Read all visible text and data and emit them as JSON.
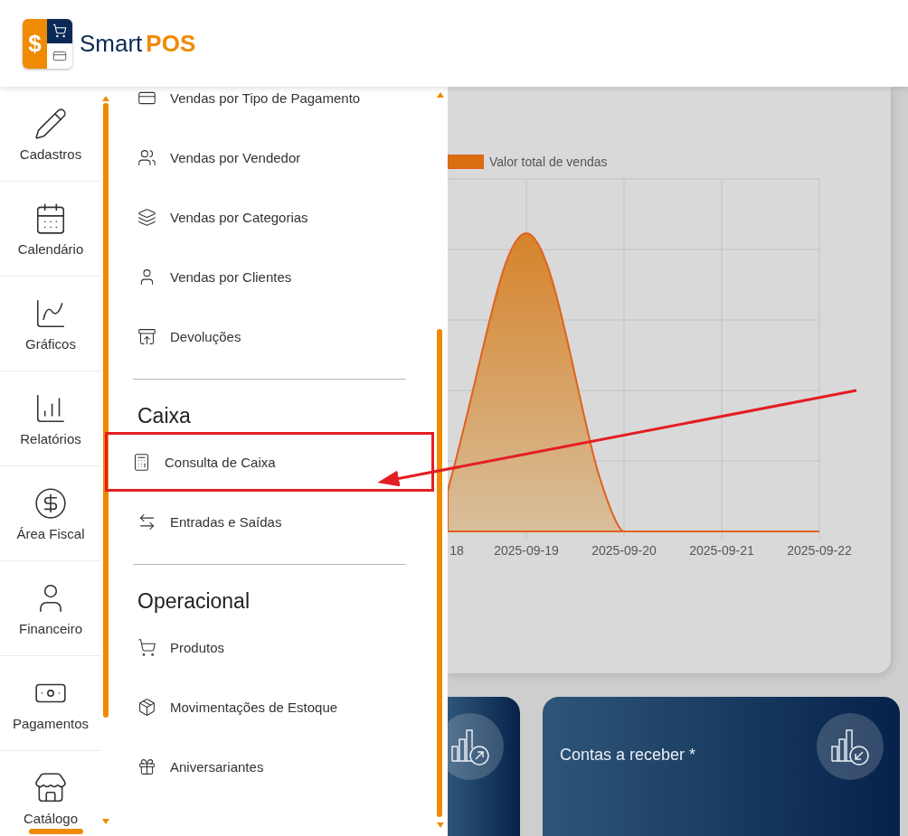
{
  "header": {
    "logo": {
      "symbol": "$",
      "brand_light": "Smart",
      "brand_bold": "POS"
    }
  },
  "rail": {
    "items": [
      {
        "label": "Cadastros"
      },
      {
        "label": "Calendário"
      },
      {
        "label": "Gráficos"
      },
      {
        "label": "Relatórios"
      },
      {
        "label": "Área Fiscal"
      },
      {
        "label": "Financeiro"
      },
      {
        "label": "Pagamentos"
      },
      {
        "label": "Catálogo"
      }
    ]
  },
  "menu": {
    "sections": [
      {
        "items": [
          {
            "label": "Vendas por Tipo de Pagamento",
            "highlighted": false
          },
          {
            "label": "Vendas por Vendedor",
            "highlighted": false
          },
          {
            "label": "Vendas por Categorias",
            "highlighted": false
          },
          {
            "label": "Vendas por Clientes",
            "highlighted": false
          },
          {
            "label": "Devoluções",
            "highlighted": false
          }
        ]
      },
      {
        "heading": "Caixa",
        "items": [
          {
            "label": "Consulta de Caixa",
            "highlighted": true
          },
          {
            "label": "Entradas e Saídas",
            "highlighted": false
          }
        ]
      },
      {
        "heading": "Operacional",
        "items": [
          {
            "label": "Produtos",
            "highlighted": false
          },
          {
            "label": "Movimentações de Estoque",
            "highlighted": false
          },
          {
            "label": "Aniversariantes",
            "highlighted": false
          }
        ]
      }
    ]
  },
  "chart": {
    "legend": "Valor total de vendas",
    "x_labels": [
      "18",
      "2025-09-19",
      "2025-09-20",
      "2025-09-21",
      "2025-09-22"
    ]
  },
  "cards": [
    {
      "kind": "arrow-out"
    },
    {
      "kind": "arrow-in",
      "title": "Contas a receber *"
    }
  ]
}
